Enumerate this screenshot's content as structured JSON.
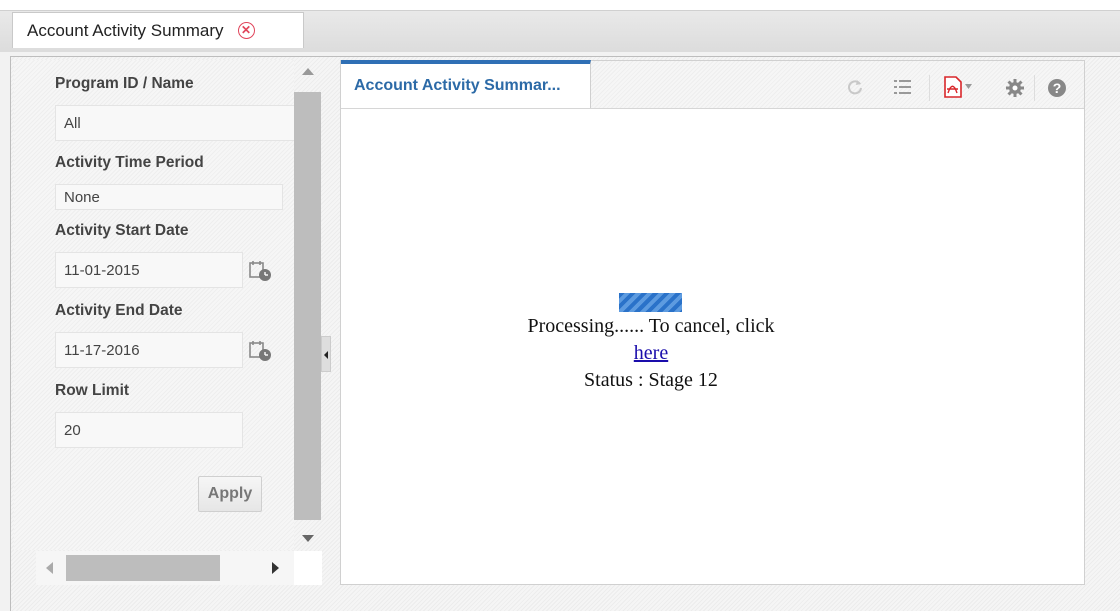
{
  "window": {
    "tab_title": "Account Activity Summary",
    "tab_close_icon": "close-circle-icon"
  },
  "filters": {
    "program": {
      "label": "Program ID / Name",
      "value": "All"
    },
    "time_period": {
      "label": "Activity Time Period",
      "value": "None"
    },
    "start_date": {
      "label": "Activity Start Date",
      "value": "11-01-2015",
      "icon": "calendar-clock-icon"
    },
    "end_date": {
      "label": "Activity End Date",
      "value": "11-17-2016",
      "icon": "calendar-clock-icon"
    },
    "row_limit": {
      "label": "Row Limit",
      "value": "20"
    },
    "apply_label": "Apply"
  },
  "report": {
    "tab_label": "Account Activity Summar...",
    "toolbar_icons": [
      "refresh-icon",
      "list-icon",
      "pdf-export-icon",
      "settings-gear-icon",
      "help-icon"
    ],
    "processing_text": "Processing...... To cancel, click",
    "cancel_link": "here",
    "status_text": "Status : Stage 12"
  },
  "colors": {
    "accent": "#2f6fb5",
    "pdf": "#d9262a",
    "progress": "#2a72c9",
    "close": "#e0445a"
  }
}
